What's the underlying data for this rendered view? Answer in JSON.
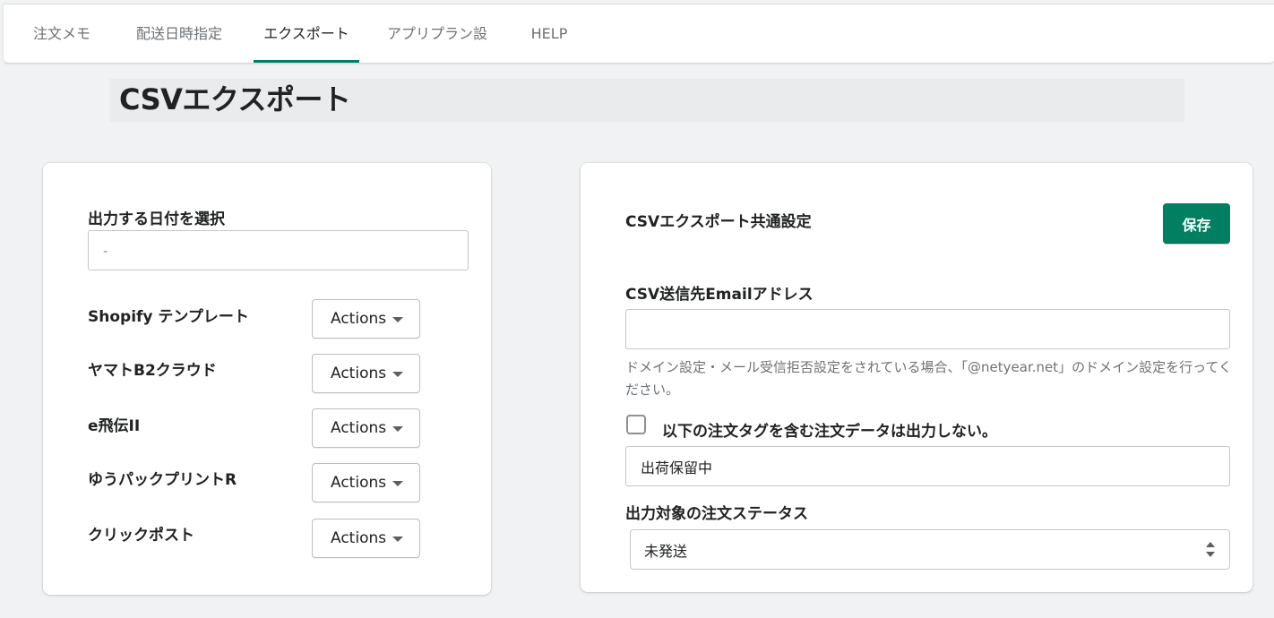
{
  "tabs": [
    {
      "label": "注文メモ",
      "active": false
    },
    {
      "label": "配送日時指定",
      "active": false
    },
    {
      "label": "エクスポート",
      "active": true
    },
    {
      "label": "アプリプラン設定",
      "active": false
    },
    {
      "label": "HELP",
      "active": false
    }
  ],
  "page": {
    "title": "CSVエクスポート"
  },
  "left_card": {
    "date_label": "出力する日付を選択",
    "date_value": "-",
    "templates": [
      {
        "name": "Shopify テンプレート",
        "action_label": "Actions"
      },
      {
        "name": "ヤマトB2クラウド",
        "action_label": "Actions"
      },
      {
        "name": "e飛伝II",
        "action_label": "Actions"
      },
      {
        "name": "ゆうパックプリントR",
        "action_label": "Actions"
      },
      {
        "name": "クリックポスト",
        "action_label": "Actions"
      }
    ]
  },
  "right_card": {
    "heading": "CSVエクスポート共通設定",
    "save_label": "保存",
    "email_label": "CSV送信先Emailアドレス",
    "email_value": "",
    "help_text": "ドメイン設定・メール受信拒否設定をされている場合、「@netyear.net」のドメイン設定を行ってください。",
    "exclude_checkbox_label": "以下の注文タグを含む注文データは出力しない。",
    "exclude_checked": false,
    "exclude_tag_value": "出荷保留中",
    "status_label": "出力対象の注文ステータス",
    "status_selected": "未発送"
  },
  "colors": {
    "accent": "#008060",
    "background": "#f1f2f3",
    "card": "#ffffff"
  }
}
